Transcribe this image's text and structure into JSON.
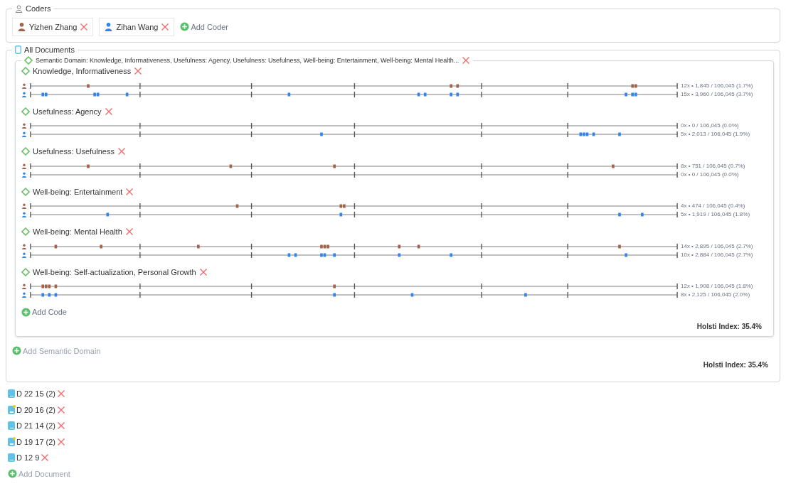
{
  "coders": {
    "legend": "Coders",
    "items": [
      {
        "name": "Yizhen Zhang",
        "color": "#a0644a"
      },
      {
        "name": "Zihan Wang",
        "color": "#2f86f0"
      }
    ],
    "add_label": "Add Coder"
  },
  "documents_group": {
    "legend": "All Documents",
    "domain": {
      "title": "Semantic Domain: Knowledge, Informativeness, Usefulness: Agency, Usefulness: Usefulness, Well-being: Entertainment, Well-being: Mental Health...",
      "codes": [
        {
          "name": "Knowledge, Informativeness",
          "readings": [
            "12x • 1,845 / 106,045 (1.7%)",
            "15x • 3,960 / 106,045 (3.7%)"
          ]
        },
        {
          "name": "Usefulness: Agency",
          "readings": [
            "0x • 0 / 106,045 (0.0%)",
            "5x • 2,013 / 106,045 (1.9%)"
          ]
        },
        {
          "name": "Usefulness: Usefulness",
          "readings": [
            "8x • 751 / 106,045 (0.7%)",
            "0x • 0 / 106,045 (0.0%)"
          ]
        },
        {
          "name": "Well-being: Entertainment",
          "readings": [
            "4x • 474 / 106,045 (0.4%)",
            "5x • 1,919 / 106,045 (1.8%)"
          ]
        },
        {
          "name": "Well-being: Mental Health",
          "readings": [
            "14x • 2,895 / 106,045 (2.7%)",
            "10x • 2,884 / 106,045 (2.7%)"
          ]
        },
        {
          "name": "Well-being: Self-actualization, Personal Growth",
          "readings": [
            "12x • 1,908 / 106,045 (1.8%)",
            "8x • 2,125 / 106,045 (2.0%)"
          ]
        }
      ],
      "add_code_label": "Add Code",
      "holsti": "Holsti Index: 35.4%"
    },
    "add_domain_label": "Add Semantic Domain",
    "holsti": "Holsti Index: 35.4%"
  },
  "documents": [
    {
      "label": "D 22 15 (2)",
      "flagged": false
    },
    {
      "label": "D 20 16 (2)",
      "flagged": true
    },
    {
      "label": "D 21 14 (2)",
      "flagged": false
    },
    {
      "label": "D 19 17 (2)",
      "flagged": true
    },
    {
      "label": "D 12 9",
      "flagged": false
    }
  ],
  "add_document_label": "Add Document"
}
